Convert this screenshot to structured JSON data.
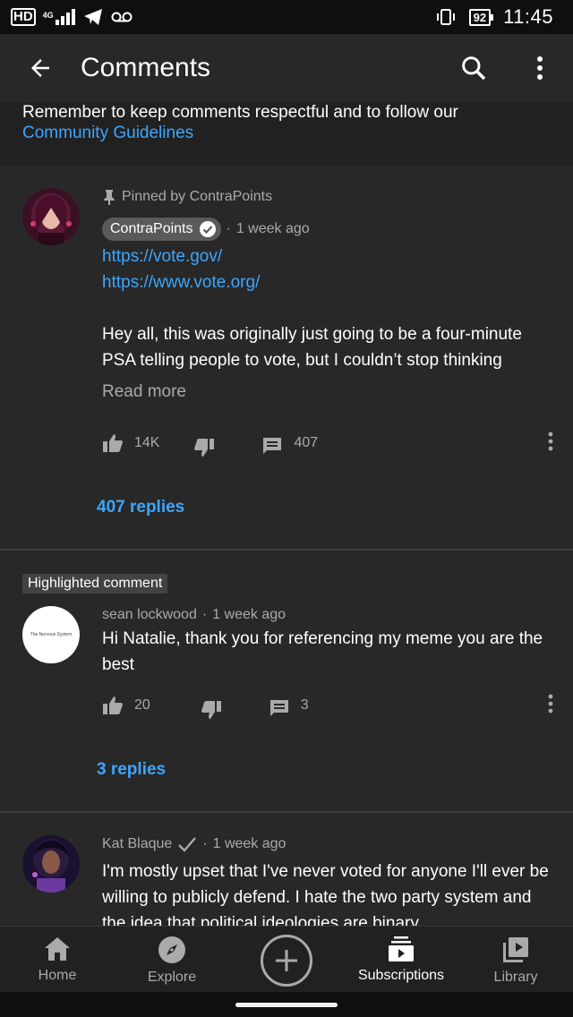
{
  "status_bar": {
    "hd": "HD",
    "network": "4G",
    "battery": "92",
    "time": "11:45"
  },
  "app_bar": {
    "title": "Comments"
  },
  "notice": {
    "text": "Remember to keep comments respectful and to follow our",
    "link": "Community Guidelines"
  },
  "comments": [
    {
      "pinned_label": "Pinned by ContraPoints",
      "author": "ContraPoints",
      "time": "1 week ago",
      "links": [
        "https://vote.gov/",
        "https://www.vote.org/"
      ],
      "text_line1": "Hey all, this was originally just going to be a four-minute",
      "text_line2": "PSA telling people to vote, but I couldn’t stop thinking",
      "read_more": "Read more",
      "likes": "14K",
      "reply_count": "407",
      "replies_label": "407 replies"
    },
    {
      "badge": "Highlighted comment",
      "author": "sean lockwood",
      "time": "1 week ago",
      "avatar_text": "The Nervous System",
      "text_line1": "Hi Natalie, thank you for referencing my meme you are the",
      "text_line2": "best",
      "likes": "20",
      "reply_count": "3",
      "replies_label": "3 replies"
    },
    {
      "author": "Kat Blaque",
      "time": "1 week ago",
      "text_line1": "I'm mostly upset that I've never voted for anyone I'll ever be",
      "text_line2": "willing to publicly defend. I hate the two party system and",
      "text_line3": "the idea that political ideologies are binary"
    }
  ],
  "bottom_nav": [
    {
      "label": "Home",
      "icon": "home-icon"
    },
    {
      "label": "Explore",
      "icon": "compass-icon"
    },
    {
      "label": "",
      "icon": "create-plus-icon"
    },
    {
      "label": "Subscriptions",
      "icon": "subscriptions-icon"
    },
    {
      "label": "Library",
      "icon": "library-icon"
    }
  ],
  "colors": {
    "background": "#282828",
    "link": "#3ea6ff",
    "secondary_text": "#aaaaaa"
  }
}
